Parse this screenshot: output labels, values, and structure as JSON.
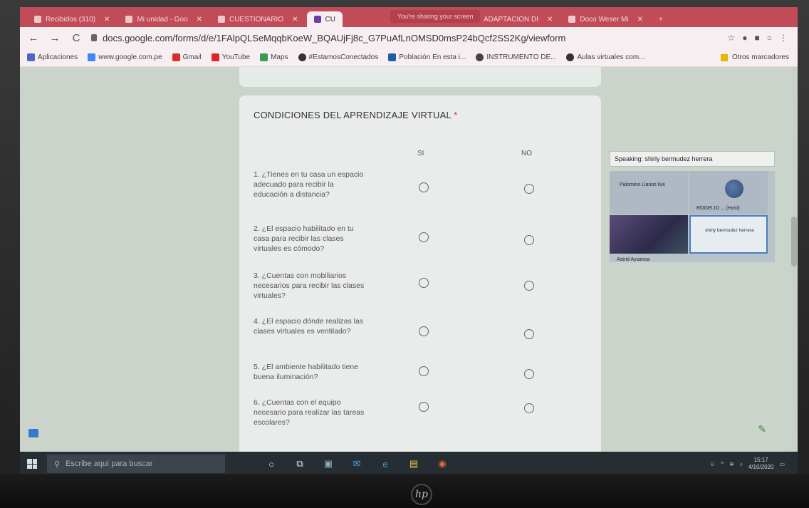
{
  "tabs": [
    {
      "label": "Recibidos (310)",
      "active": false
    },
    {
      "label": "Mi unidad - Goo",
      "active": false
    },
    {
      "label": "CUESTIONARIO",
      "active": false
    },
    {
      "label": "CU",
      "active": true
    },
    {
      "label": "ADAPTACION DI",
      "active": false
    },
    {
      "label": "Doco Weser Mi",
      "active": false
    }
  ],
  "sharing_banner": "You're sharing your screen",
  "address": {
    "url": "docs.google.com/forms/d/e/1FAlpQLSeMqqbKoeW_BQAUjFj8c_G7PuAfLnOMSD0msP24bQcf2SS2Kg/viewform"
  },
  "bookmarks": [
    {
      "label": "Aplicaciones",
      "color": "#4a67c8"
    },
    {
      "label": "www.google.com.pe",
      "color": "#4285f4"
    },
    {
      "label": "Gmail",
      "color": "#d93025"
    },
    {
      "label": "YouTube",
      "color": "#e02424"
    },
    {
      "label": "Maps",
      "color": "#3a9a52"
    },
    {
      "label": "#EstamosConectados",
      "color": "#333333"
    },
    {
      "label": "Población En esta i...",
      "color": "#1f5fa8"
    },
    {
      "label": "INSTRUMENTO DE...",
      "color": "#444444"
    },
    {
      "label": "Aulas virtuales com...",
      "color": "#333333"
    }
  ],
  "bookmarks_other": "Otros marcadores",
  "form": {
    "title": "CONDICIONES DEL APRENDIZAJE VIRTUAL",
    "required_mark": "*",
    "columns": [
      "SI",
      "NO"
    ],
    "questions": [
      "1. ¿Tienes en tu casa un espacio adecuado para recibir la educación a distancia?",
      "2. ¿El espacio habilitado en tu casa para recibir las clases virtuales es cómodo?",
      "3. ¿Cuentas con mobiliarios necesarios para recibir las clases virtuales?",
      "4. ¿El espacio dónde realizas las clases virtuales es ventilado?",
      "5. ¿El ambiente habilitado tiene buena iluminación?",
      "6. ¿Cuentas con el equipo necesario para realizar las tareas escolares?"
    ]
  },
  "meet": {
    "speaking": "Speaking: shirly bermudez herrera",
    "participants": [
      "Palomino Llanos Kei",
      "ROGELIO ... (Host)",
      "Astrid Aysanoa",
      "shirly bermudez herrera"
    ]
  },
  "taskbar": {
    "search_placeholder": "Escribe aquí para buscar",
    "time": "15:17",
    "date": "4/10/2020"
  },
  "brand": "hp"
}
